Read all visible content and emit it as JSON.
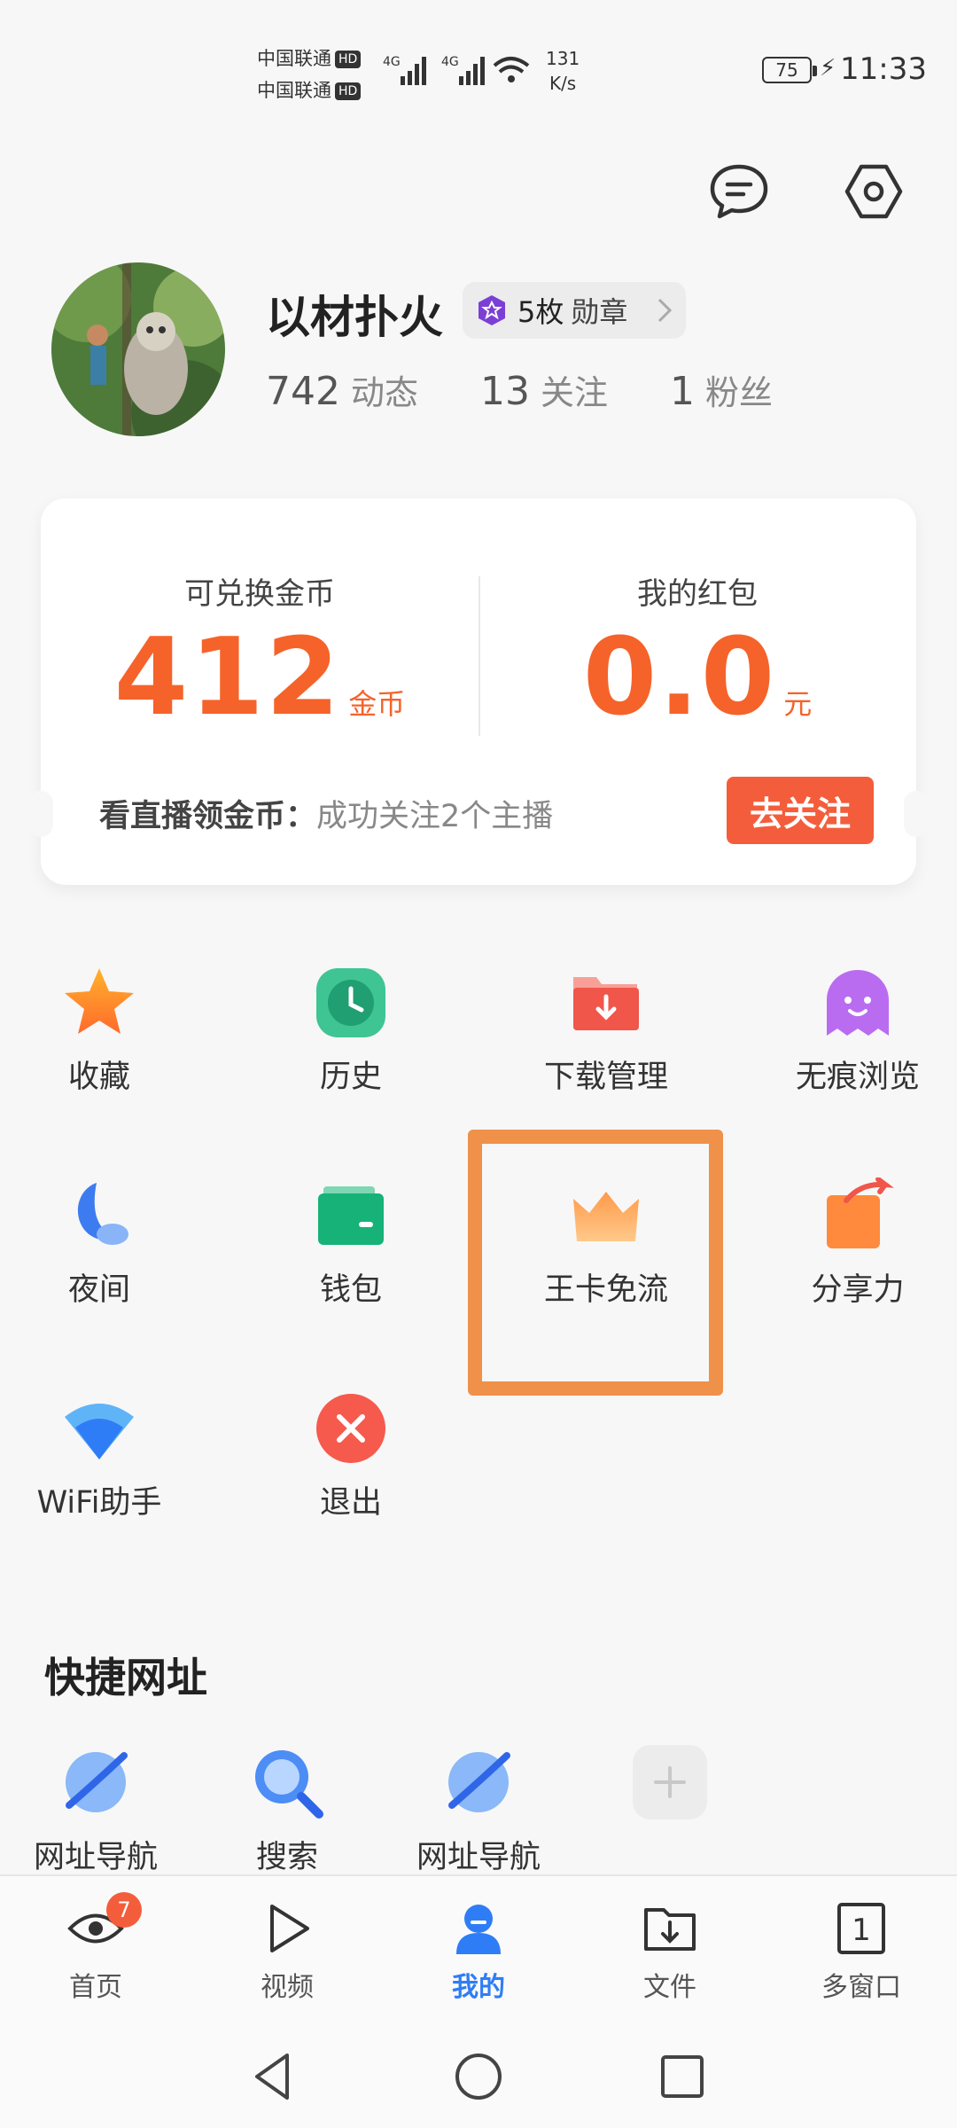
{
  "status_bar": {
    "carrier_1": "中国联通",
    "carrier_2": "中国联通",
    "hd": "HD",
    "net_type": "4G",
    "speed_value": "131",
    "speed_unit": "K/s",
    "battery": "75",
    "time": "11:33"
  },
  "header": {
    "message_icon": "message-bubble-icon",
    "settings_icon": "hexagon-settings-icon"
  },
  "profile": {
    "username": "以材扑火",
    "medal_count": "5枚",
    "medal_label": "勋章",
    "stats": [
      {
        "value": "742",
        "label": "动态"
      },
      {
        "value": "13",
        "label": "关注"
      },
      {
        "value": "1",
        "label": "粉丝"
      }
    ]
  },
  "coin_card": {
    "coins_title": "可兑换金币",
    "coins_value": "412",
    "coins_unit": "金币",
    "redpacket_title": "我的红包",
    "redpacket_value": "0.0",
    "redpacket_unit": "元",
    "task_title": "看直播领金币：",
    "task_desc": "成功关注2个主播",
    "task_button": "去关注",
    "accent_color": "#f5632a"
  },
  "grid": [
    {
      "label": "收藏",
      "icon": "star-icon"
    },
    {
      "label": "历史",
      "icon": "clock-icon"
    },
    {
      "label": "下载管理",
      "icon": "download-folder-icon"
    },
    {
      "label": "无痕浏览",
      "icon": "ghost-icon"
    },
    {
      "label": "夜间",
      "icon": "moon-icon"
    },
    {
      "label": "钱包",
      "icon": "wallet-icon"
    },
    {
      "label": "王卡免流",
      "icon": "crown-icon"
    },
    {
      "label": "分享力",
      "icon": "share-icon"
    },
    {
      "label": "WiFi助手",
      "icon": "wifi-icon"
    },
    {
      "label": "退出",
      "icon": "exit-icon"
    }
  ],
  "quick_links": {
    "title": "快捷网址",
    "items": [
      {
        "label": "网址导航",
        "icon": "planet-icon"
      },
      {
        "label": "搜索",
        "icon": "search-icon"
      },
      {
        "label": "网址导航",
        "icon": "planet-icon"
      },
      {
        "label": "",
        "icon": "add-icon"
      }
    ]
  },
  "bottom_nav": [
    {
      "label": "首页",
      "icon": "eye-icon",
      "badge": "7"
    },
    {
      "label": "视频",
      "icon": "play-icon"
    },
    {
      "label": "我的",
      "icon": "person-icon",
      "active": true
    },
    {
      "label": "文件",
      "icon": "folder-download-icon"
    },
    {
      "label": "多窗口",
      "icon": "window-count-icon",
      "count": "1"
    }
  ],
  "highlight_color": "#f0914a"
}
